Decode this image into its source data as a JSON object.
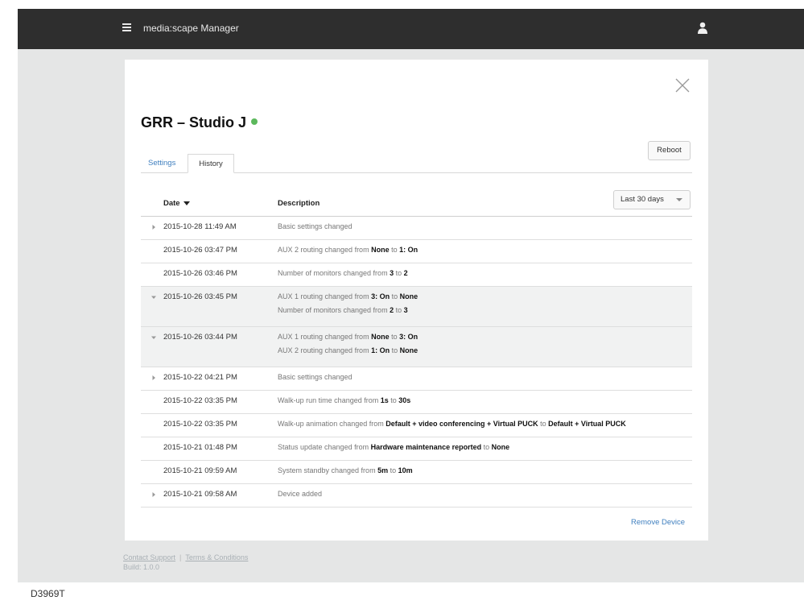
{
  "app": {
    "title": "media:scape Manager"
  },
  "device": {
    "name": "GRR – Studio J",
    "status_color": "#5cb85c"
  },
  "tabs": [
    {
      "label": "Settings"
    },
    {
      "label": "History"
    }
  ],
  "buttons": {
    "reboot": "Reboot",
    "remove_device": "Remove Device"
  },
  "filter": {
    "selected": "Last 30 days"
  },
  "table": {
    "headers": {
      "date": "Date",
      "description": "Description"
    },
    "rows": [
      {
        "date": "2015-10-28 11:49 AM",
        "expand": "collapsed",
        "lines": [
          [
            {
              "t": "Basic settings changed"
            }
          ]
        ]
      },
      {
        "date": "2015-10-26 03:47 PM",
        "expand": "none",
        "lines": [
          [
            {
              "t": "AUX 2 routing changed from "
            },
            {
              "t": "None",
              "b": true
            },
            {
              "t": " to "
            },
            {
              "t": "1: On",
              "b": true
            }
          ]
        ]
      },
      {
        "date": "2015-10-26 03:46 PM",
        "expand": "none",
        "lines": [
          [
            {
              "t": "Number of monitors changed from "
            },
            {
              "t": "3",
              "b": true
            },
            {
              "t": " to "
            },
            {
              "t": "2",
              "b": true
            }
          ]
        ]
      },
      {
        "date": "2015-10-26 03:45 PM",
        "expand": "expanded",
        "lines": [
          [
            {
              "t": "AUX 1 routing changed from "
            },
            {
              "t": "3: On",
              "b": true
            },
            {
              "t": " to "
            },
            {
              "t": "None",
              "b": true
            }
          ],
          [
            {
              "t": "Number of monitors changed from "
            },
            {
              "t": "2",
              "b": true
            },
            {
              "t": " to "
            },
            {
              "t": "3",
              "b": true
            }
          ]
        ]
      },
      {
        "date": "2015-10-26 03:44 PM",
        "expand": "expanded",
        "lines": [
          [
            {
              "t": "AUX 1 routing changed from "
            },
            {
              "t": "None",
              "b": true
            },
            {
              "t": " to "
            },
            {
              "t": "3: On",
              "b": true
            }
          ],
          [
            {
              "t": "AUX 2 routing changed from "
            },
            {
              "t": "1: On",
              "b": true
            },
            {
              "t": " to "
            },
            {
              "t": "None",
              "b": true
            }
          ]
        ]
      },
      {
        "date": "2015-10-22 04:21 PM",
        "expand": "collapsed",
        "lines": [
          [
            {
              "t": "Basic settings changed"
            }
          ]
        ]
      },
      {
        "date": "2015-10-22 03:35 PM",
        "expand": "none",
        "lines": [
          [
            {
              "t": "Walk-up run time changed from "
            },
            {
              "t": "1s",
              "b": true
            },
            {
              "t": " to "
            },
            {
              "t": "30s",
              "b": true
            }
          ]
        ]
      },
      {
        "date": "2015-10-22 03:35 PM",
        "expand": "none",
        "lines": [
          [
            {
              "t": "Walk-up animation changed from "
            },
            {
              "t": "Default + video conferencing + Virtual PUCK",
              "b": true
            },
            {
              "t": " to "
            },
            {
              "t": "Default + Virtual PUCK",
              "b": true
            }
          ]
        ]
      },
      {
        "date": "2015-10-21 01:48 PM",
        "expand": "none",
        "lines": [
          [
            {
              "t": "Status update changed from "
            },
            {
              "t": "Hardware maintenance reported",
              "b": true
            },
            {
              "t": " to "
            },
            {
              "t": "None",
              "b": true
            }
          ]
        ]
      },
      {
        "date": "2015-10-21 09:59 AM",
        "expand": "none",
        "lines": [
          [
            {
              "t": "System standby changed from "
            },
            {
              "t": "5m",
              "b": true
            },
            {
              "t": " to "
            },
            {
              "t": "10m",
              "b": true
            }
          ]
        ]
      },
      {
        "date": "2015-10-21 09:58 AM",
        "expand": "collapsed",
        "lines": [
          [
            {
              "t": "Device added"
            }
          ]
        ]
      }
    ]
  },
  "footer": {
    "contact_support": "Contact Support",
    "separator": "|",
    "terms": "Terms & Conditions",
    "build": "Build: 1.0.0"
  },
  "document_code": "D3969T",
  "icons": {
    "menu": "hamburger-icon",
    "user": "user-icon",
    "close": "close-icon",
    "row_collapsed": "chevron-right-icon",
    "row_expanded": "chevron-down-icon",
    "sort": "sort-desc-icon",
    "dropdown": "caret-down-icon"
  }
}
